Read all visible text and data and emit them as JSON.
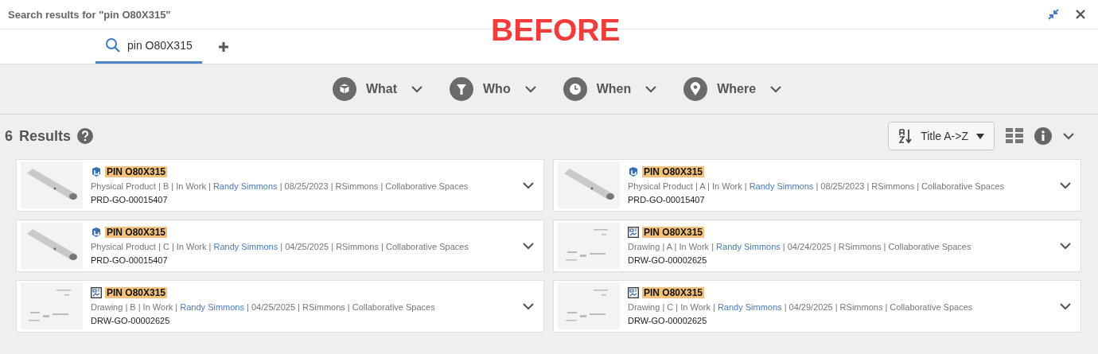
{
  "header": {
    "title": "Search results for \"pin O80X315\""
  },
  "annotation": "BEFORE",
  "tabs": [
    {
      "label": "pin O80X315",
      "selected": true
    }
  ],
  "filters": [
    {
      "kind": "what",
      "label": "What"
    },
    {
      "kind": "who",
      "label": "Who"
    },
    {
      "kind": "when",
      "label": "When"
    },
    {
      "kind": "where",
      "label": "Where"
    }
  ],
  "results_header": {
    "count": "6",
    "label": "Results",
    "sort": "Title A->Z"
  },
  "results": [
    {
      "kind": "product",
      "title": "PIN O80X315",
      "details_before": "Physical Product | B | In Work |",
      "owner": "Randy Simmons",
      "details_after": "| 08/25/2023 | RSimmons | Collaborative Spaces",
      "id": "PRD-GO-00015407"
    },
    {
      "kind": "product",
      "title": "PIN O80X315",
      "details_before": "Physical Product | A | In Work |",
      "owner": "Randy Simmons",
      "details_after": "| 08/25/2023 | RSimmons | Collaborative Spaces",
      "id": "PRD-GO-00015407"
    },
    {
      "kind": "product",
      "title": "PIN O80X315",
      "details_before": "Physical Product | C | In Work |",
      "owner": "Randy Simmons",
      "details_after": "| 04/25/2025 | RSimmons | Collaborative Spaces",
      "id": "PRD-GO-00015407"
    },
    {
      "kind": "drawing",
      "title": "PIN O80X315",
      "details_before": "Drawing | A | In Work |",
      "owner": "Randy Simmons",
      "details_after": "| 04/24/2025 | RSimmons | Collaborative Spaces",
      "id": "DRW-GO-00002625"
    },
    {
      "kind": "drawing",
      "title": "PIN O80X315",
      "details_before": "Drawing | B | In Work |",
      "owner": "Randy Simmons",
      "details_after": "| 04/25/2025 | RSimmons | Collaborative Spaces",
      "id": "DRW-GO-00002625"
    },
    {
      "kind": "drawing",
      "title": "PIN O80X315",
      "details_before": "Drawing | C | In Work |",
      "owner": "Randy Simmons",
      "details_after": "| 04/29/2025 | RSimmons | Collaborative Spaces",
      "id": "DRW-GO-00002625"
    }
  ]
}
